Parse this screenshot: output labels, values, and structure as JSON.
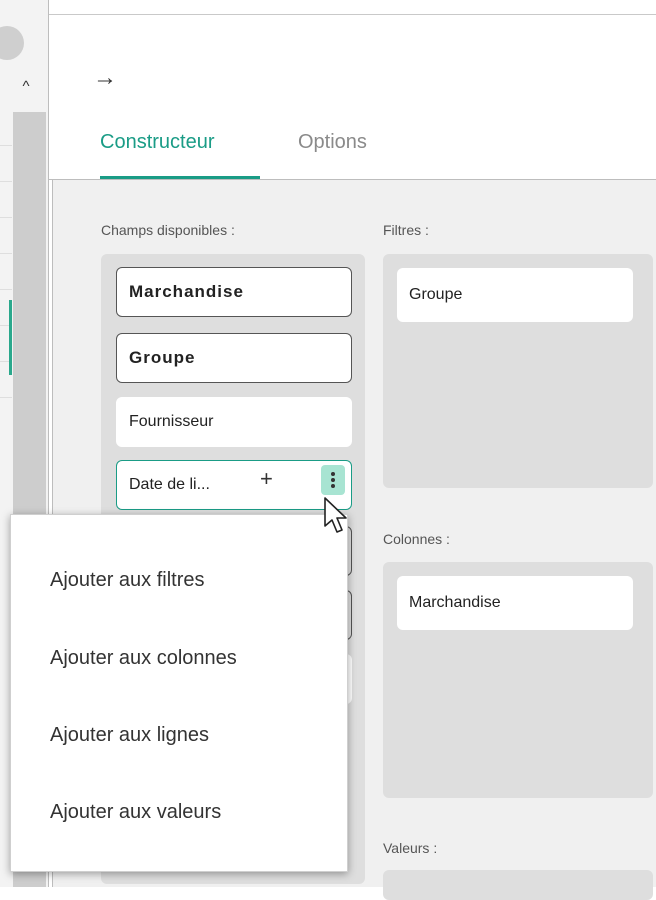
{
  "strip": {
    "up_glyph": "^"
  },
  "header": {
    "arrow_glyph": "→"
  },
  "tabs": [
    {
      "label": "Constructeur",
      "active": true
    },
    {
      "label": "Options",
      "active": false
    }
  ],
  "accent_color": "#1a9c86",
  "available": {
    "label": "Champs disponibles :",
    "fields": [
      {
        "label": "Marchandise",
        "used": true
      },
      {
        "label": "Groupe",
        "used": true
      },
      {
        "label": "Fournisseur",
        "used": false
      },
      {
        "label": "Date de li...",
        "used": false
      }
    ],
    "plus_glyph": "+"
  },
  "filters": {
    "label": "Filtres :",
    "items": [
      "Groupe"
    ]
  },
  "columns": {
    "label": "Colonnes :",
    "items": [
      "Marchandise"
    ]
  },
  "values": {
    "label": "Valeurs :"
  },
  "context_menu": {
    "items": [
      "Ajouter aux filtres",
      "Ajouter aux colonnes",
      "Ajouter aux lignes",
      "Ajouter aux valeurs"
    ]
  }
}
